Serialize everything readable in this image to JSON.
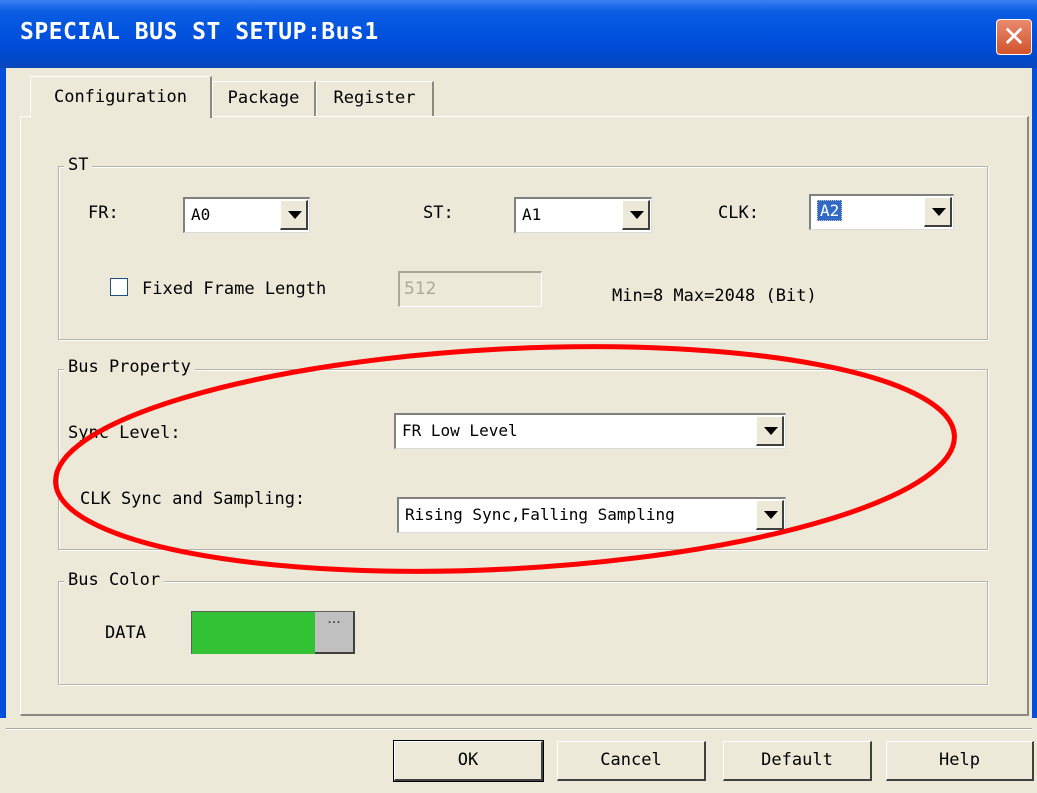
{
  "window": {
    "title": "SPECIAL BUS ST SETUP:Bus1",
    "close_glyph": "✕"
  },
  "tabs": [
    {
      "label": "Configuration",
      "active": true
    },
    {
      "label": "Package",
      "active": false
    },
    {
      "label": "Register",
      "active": false
    }
  ],
  "st_group": {
    "legend": "ST",
    "fr": {
      "label": "FR:",
      "value": "A0"
    },
    "st": {
      "label": "ST:",
      "value": "A1"
    },
    "clk": {
      "label": "CLK:",
      "value": "A2"
    },
    "fixed_frame": {
      "label": "Fixed Frame Length",
      "checked": false,
      "value": "512"
    },
    "range_text": "Min=8  Max=2048 (Bit)"
  },
  "bus_property": {
    "legend": "Bus Property",
    "sync_level": {
      "label": "Sync Level:",
      "value": "FR Low Level"
    },
    "clk_sync": {
      "label": "CLK Sync and Sampling:",
      "value": "Rising Sync,Falling Sampling"
    }
  },
  "bus_color": {
    "legend": "Bus Color",
    "data_label": "DATA",
    "data_color": "#33c233",
    "picker_glyph": "···"
  },
  "buttons": {
    "ok": "OK",
    "cancel": "Cancel",
    "default": "Default",
    "help": "Help"
  },
  "annotation_color": "#ff0000"
}
